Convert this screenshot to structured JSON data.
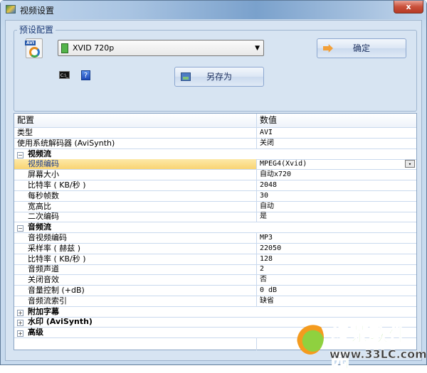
{
  "window": {
    "title": "视频设置",
    "close_label": "x"
  },
  "preset": {
    "group_label": "预设配置",
    "avi_icon_label": "AVI",
    "selected_preset": "XVID 720p",
    "ok_label": "确定",
    "save_as_label": "另存为",
    "cmd_icon_label": "C:\\_",
    "help_icon_label": "?"
  },
  "grid": {
    "headers": [
      "配置",
      "数值"
    ],
    "rows": [
      {
        "k": "类型",
        "v": "AVI"
      },
      {
        "k": "使用系统解码器 (AviSynth)",
        "v": "关闭"
      },
      {
        "k": "视频流",
        "cat": true,
        "exp": "−"
      },
      {
        "k": "视频编码",
        "v": "MPEG4(Xvid)",
        "child": true
      },
      {
        "k": "屏幕大小",
        "v": "自动x720",
        "child": true
      },
      {
        "k": "比特率 ( KB/秒 )",
        "v": "2048",
        "child": true
      },
      {
        "k": "每秒帧数",
        "v": "30",
        "child": true
      },
      {
        "k": "宽高比",
        "v": "自动",
        "child": true
      },
      {
        "k": "二次编码",
        "v": "是",
        "child": true
      },
      {
        "k": "音频流",
        "cat": true,
        "exp": "−"
      },
      {
        "k": "音视频编码",
        "v": "MP3",
        "child": true
      },
      {
        "k": "采样率 ( 赫兹 )",
        "v": "22050",
        "child": true
      },
      {
        "k": "比特率 ( KB/秒 )",
        "v": "128",
        "child": true
      },
      {
        "k": "音频声道",
        "v": "2",
        "child": true
      },
      {
        "k": "关闭音效",
        "v": "否",
        "child": true
      },
      {
        "k": "音量控制 (+dB)",
        "v": "0 dB",
        "child": true
      },
      {
        "k": "音频流索引",
        "v": "缺省",
        "child": true
      },
      {
        "k": "附加字幕",
        "cat": true,
        "exp": "+"
      },
      {
        "k": "水印 (AviSynth)",
        "cat": true,
        "exp": "+"
      },
      {
        "k": "高级",
        "cat": true,
        "exp": "+"
      }
    ],
    "selected_row": 3
  },
  "watermark": {
    "name": "绿茶软件园",
    "url": "www.33LC.com"
  }
}
